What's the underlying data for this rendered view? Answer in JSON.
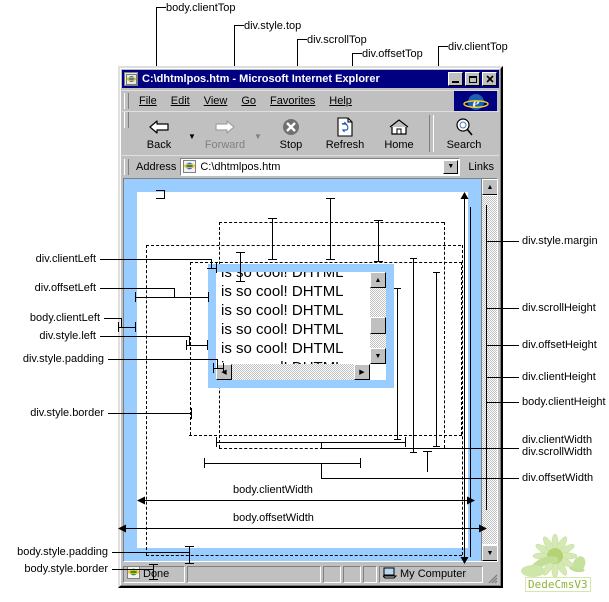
{
  "window": {
    "title": "C:\\dhtmlpos.htm - Microsoft Internet Explorer",
    "minimize_label": "_",
    "maximize_label": "□",
    "close_label": "×",
    "app_icon": "ie-document-icon"
  },
  "menu": {
    "items": [
      {
        "label": "File",
        "accel": "F"
      },
      {
        "label": "Edit",
        "accel": "E"
      },
      {
        "label": "View",
        "accel": "V"
      },
      {
        "label": "Go",
        "accel": "G"
      },
      {
        "label": "Favorites",
        "accel": "a"
      },
      {
        "label": "Help",
        "accel": "H"
      }
    ]
  },
  "toolbar": {
    "buttons": [
      {
        "label": "Back",
        "icon": "back-arrow-icon",
        "disabled": false,
        "has_dropdown": true
      },
      {
        "label": "Forward",
        "icon": "forward-arrow-icon",
        "disabled": true,
        "has_dropdown": true
      },
      {
        "label": "Stop",
        "icon": "stop-icon",
        "disabled": false,
        "has_dropdown": false
      },
      {
        "label": "Refresh",
        "icon": "refresh-icon",
        "disabled": false,
        "has_dropdown": false
      },
      {
        "label": "Home",
        "icon": "home-icon",
        "disabled": false,
        "has_dropdown": false
      },
      {
        "label": "Search",
        "icon": "search-icon",
        "disabled": false,
        "has_dropdown": false
      }
    ]
  },
  "address": {
    "label": "Address",
    "value": "C:\\dhtmlpos.htm",
    "placeholder": "",
    "links_label": "Links"
  },
  "status": {
    "text": "Done",
    "zone": "My Computer"
  },
  "div_content": {
    "text": "is so cool! DHTML is so cool! DHTML is so cool! DHTML is so cool! DHTML is so cool! DHTML is so cool! DHTML is"
  },
  "watermark": {
    "text": "DedeCmsV3"
  },
  "colors": {
    "page_border_blue": "#99ccff",
    "titlebar_blue": "#000080",
    "chrome_gray": "#c0c0c0",
    "client_white": "#ffffff"
  },
  "annotations": {
    "top": [
      {
        "id": "body-clienttop",
        "label": "body.clientTop"
      },
      {
        "id": "div-styletop",
        "label": "div.style.top"
      },
      {
        "id": "div-scrolltop",
        "label": "div.scrollTop"
      },
      {
        "id": "div-offsettop",
        "label": "div.offsetTop"
      },
      {
        "id": "div-clienttop",
        "label": "div.clientTop"
      }
    ],
    "left": [
      {
        "id": "div-clientleft",
        "label": "div.clientLeft"
      },
      {
        "id": "div-offsetleft",
        "label": "div.offsetLeft"
      },
      {
        "id": "body-clientleft",
        "label": "body.clientLeft"
      },
      {
        "id": "div-styleleft",
        "label": "div.style.left"
      },
      {
        "id": "div-stylepadding",
        "label": "div.style.padding"
      },
      {
        "id": "div-styleborder",
        "label": "div.style.border"
      },
      {
        "id": "body-stylepadding",
        "label": "body.style.padding"
      },
      {
        "id": "body-styleborder",
        "label": "body.style.border"
      }
    ],
    "right": [
      {
        "id": "div-stylemargin",
        "label": "div.style.margin"
      },
      {
        "id": "div-scrollheight",
        "label": "div.scrollHeight"
      },
      {
        "id": "div-offsetheight",
        "label": "div.offsetHeight"
      },
      {
        "id": "div-clientheight",
        "label": "div.clientHeight"
      },
      {
        "id": "body-clientheight",
        "label": "body.clientHeight"
      },
      {
        "id": "div-clientwidth",
        "label": "div.clientWidth"
      },
      {
        "id": "div-scrollwidth",
        "label": "div.scrollWidth"
      },
      {
        "id": "div-offsetwidth",
        "label": "div.offsetWidth"
      }
    ],
    "center": [
      {
        "id": "body-clientwidth",
        "label": "body.clientWidth"
      },
      {
        "id": "body-offsetwidth",
        "label": "body.offsetWidth"
      }
    ]
  }
}
